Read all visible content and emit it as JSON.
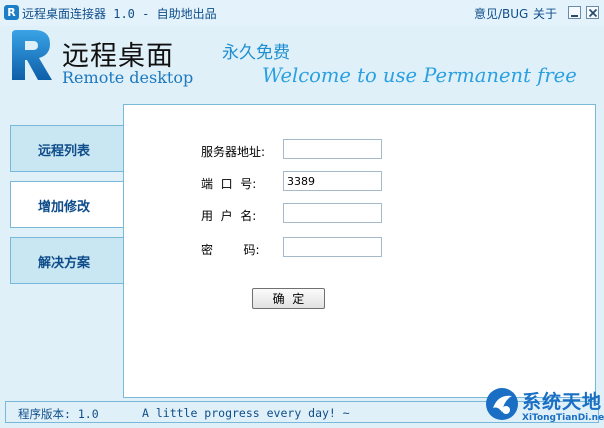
{
  "window": {
    "title": "远程桌面连接器 1.0 - 自助地出品",
    "links": {
      "feedback": "意见/BUG",
      "about": "关于"
    }
  },
  "header": {
    "logo_cn": "远程桌面",
    "logo_en": "Remote desktop",
    "free_label": "永久免费",
    "welcome": "Welcome to use  Permanent free"
  },
  "nav": {
    "items": [
      {
        "label": "远程列表"
      },
      {
        "label": "增加修改"
      },
      {
        "label": "解决方案"
      }
    ],
    "active_index": 1
  },
  "form": {
    "server_label": "服务器地址:",
    "server_value": "",
    "port_label": "端  口  号:",
    "port_value": "3389",
    "user_label": "用  户  名:",
    "user_value": "",
    "password_label": "密        码:",
    "password_value": "",
    "ok_label": "确  定"
  },
  "status": {
    "version": "程序版本: 1.0",
    "message": "A little progress every day! ~"
  },
  "watermark": {
    "name_cn": "系统天地",
    "url": "XiTongTianDi.net"
  },
  "colors": {
    "background": "#dff0f9",
    "accent": "#1b7ec6",
    "border": "#79b8d8",
    "nav_text": "#0f4d8a"
  }
}
